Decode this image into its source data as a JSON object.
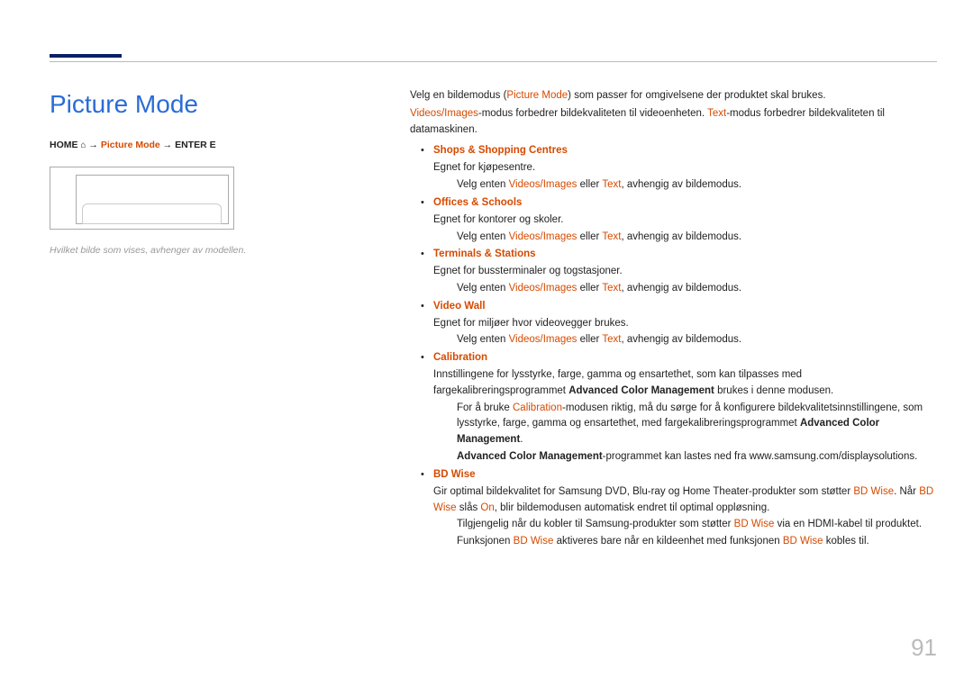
{
  "page_title": "Picture Mode",
  "breadcrumb": {
    "home": "HOME",
    "home_icon": "⌂",
    "arrow": "→",
    "picture_mode": "Picture Mode",
    "enter": "ENTER E"
  },
  "image_note": "Hvilket bilde som vises, avhenger av modellen.",
  "intro": {
    "p1_before": "Velg en bildemodus (",
    "p1_accent": "Picture Mode",
    "p1_after": ") som passer for omgivelsene der produktet skal brukes.",
    "p2_accent1": "Videos/Images",
    "p2_mid": "-modus forbedrer bildekvaliteten til videoenheten. ",
    "p2_accent2": "Text",
    "p2_after": "-modus forbedrer bildekvaliteten til datamaskinen."
  },
  "shared": {
    "velg_enten_prefix": "Velg enten ",
    "vi": "Videos/Images",
    "eller": " eller ",
    "text": "Text",
    "velg_enten_suffix": ", avhengig av bildemodus."
  },
  "items": {
    "shops": {
      "title": "Shops & Shopping Centres",
      "desc": "Egnet for kjøpesentre."
    },
    "offices": {
      "title": "Offices & Schools",
      "desc": "Egnet for kontorer og skoler."
    },
    "terminals": {
      "title": "Terminals & Stations",
      "desc": "Egnet for bussterminaler og togstasjoner."
    },
    "videowall": {
      "title": "Video Wall",
      "desc": "Egnet for miljøer hvor videovegger brukes."
    },
    "calibration": {
      "title": "Calibration",
      "desc_before": "Innstillingene for lysstyrke, farge, gamma og ensartethet, som kan tilpasses med fargekalibreringsprogrammet ",
      "desc_bold": "Advanced Color Management",
      "desc_after": " brukes i denne modusen.",
      "sub1_before": "For å bruke ",
      "sub1_accent": "Calibration",
      "sub1_mid": "-modusen riktig, må du sørge for å konfigurere bildekvalitetsinnstillingene, som lysstyrke, farge, gamma og ensartethet, med fargekalibreringsprogrammet ",
      "sub1_bold": "Advanced Color Management",
      "sub1_after": ".",
      "sub2_bold": "Advanced Color Management",
      "sub2_after": "-programmet kan lastes ned fra www.samsung.com/displaysolutions."
    },
    "bdwise": {
      "title": "BD Wise",
      "desc_before": "Gir optimal bildekvalitet for Samsung DVD, Blu-ray og Home Theater-produkter som støtter ",
      "bd": "BD Wise",
      "desc_mid": ". Når ",
      "desc_mid2": " slås ",
      "on": "On",
      "desc_after": ", blir bildemodusen automatisk endret til optimal oppløsning.",
      "sub1_before": "Tilgjengelig når du kobler til Samsung-produkter som støtter ",
      "sub1_after": " via en HDMI-kabel til produktet.",
      "sub2_before": "Funksjonen ",
      "sub2_mid": " aktiveres bare når en kildeenhet med funksjonen ",
      "sub2_after": " kobles til."
    }
  },
  "page_number": "91"
}
